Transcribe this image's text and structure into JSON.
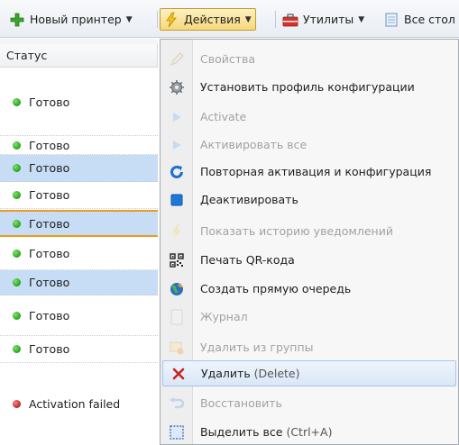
{
  "toolbar": {
    "new_printer": "Новый принтер",
    "actions": "Действия",
    "utilities": "Утилиты",
    "all_tables": "Все стол"
  },
  "status_column": {
    "header": "Статус",
    "rows": [
      "Готово",
      "Готово",
      "Готово",
      "Готово",
      "Готово",
      "Готово",
      "Готово",
      "Готово",
      "Готово",
      "Activation failed"
    ]
  },
  "menu": {
    "items": [
      {
        "label": "Свойства",
        "icon": "pencil-icon",
        "enabled": false
      },
      {
        "label": "Установить профиль конфигурации",
        "icon": "gear-icon",
        "enabled": true
      },
      {
        "label": "Activate",
        "icon": "play-icon",
        "enabled": false
      },
      {
        "label": "Активировать все",
        "icon": "play-icon",
        "enabled": false
      },
      {
        "label": "Повторная активация и конфигурация",
        "icon": "refresh-icon",
        "enabled": true
      },
      {
        "label": "Деактивировать",
        "icon": "stop-icon",
        "enabled": true
      },
      {
        "label": "Показать историю уведомлений",
        "icon": "lightning-icon",
        "enabled": false
      },
      {
        "label": "Печать QR-кода",
        "icon": "qr-code-icon",
        "enabled": true
      },
      {
        "label": "Создать прямую очередь",
        "icon": "globe-icon",
        "enabled": true
      },
      {
        "label": "Журнал",
        "icon": "journal-icon",
        "enabled": false
      },
      {
        "label": "Удалить из группы",
        "icon": "remove-from-group-icon",
        "enabled": false
      },
      {
        "label": "Удалить",
        "shortcut": "(Delete)",
        "icon": "delete-x-icon",
        "enabled": true
      },
      {
        "label": "Восстановить",
        "icon": "restore-icon",
        "enabled": false
      },
      {
        "label": "Выделить все",
        "shortcut": "(Ctrl+A)",
        "icon": "select-all-icon",
        "enabled": true
      }
    ]
  },
  "colors": {
    "selected_row": "#c7dcf5",
    "focus_line": "#f09a1c",
    "status_ok": "#26a11a",
    "status_error": "#c41e1e"
  }
}
